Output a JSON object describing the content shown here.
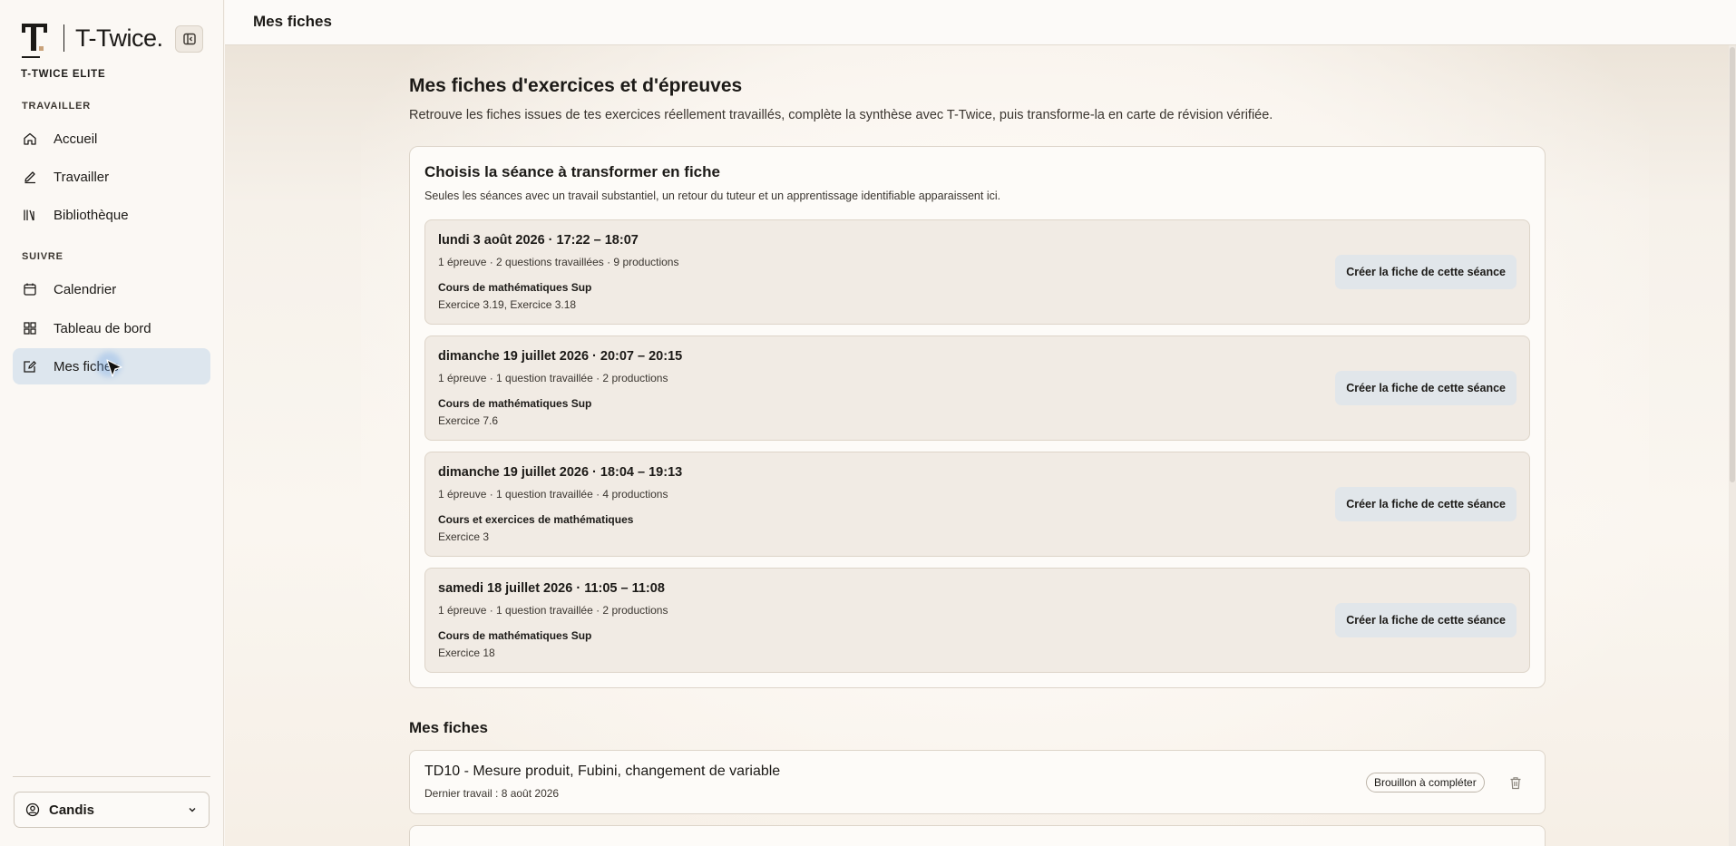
{
  "app": {
    "brand_name": "T-Twice.",
    "plan": "T-TWICE ELITE"
  },
  "sidebar": {
    "sections": [
      {
        "label": "TRAVAILLER"
      },
      {
        "label": "SUIVRE"
      }
    ],
    "items": [
      {
        "label": "Accueil",
        "icon": "home-icon"
      },
      {
        "label": "Travailler",
        "icon": "pencil-icon"
      },
      {
        "label": "Bibliothèque",
        "icon": "library-icon"
      },
      {
        "label": "Calendrier",
        "icon": "calendar-icon"
      },
      {
        "label": "Tableau de bord",
        "icon": "dashboard-icon"
      },
      {
        "label": "Mes fiches",
        "icon": "edit-note-icon",
        "active": true
      }
    ],
    "user": {
      "name": "Candis",
      "icon": "user-circle-icon"
    }
  },
  "topbar": {
    "title": "Mes fiches"
  },
  "main": {
    "title": "Mes fiches d'exercices et d'épreuves",
    "description": "Retrouve les fiches issues de tes exercices réellement travaillés, complète la synthèse avec T-Twice, puis transforme-la en carte de révision vérifiée.",
    "session_panel": {
      "title": "Choisis la séance à transformer en fiche",
      "subtitle": "Seules les séances avec un travail substantiel, un retour du tuteur et un apprentissage identifiable apparaissent ici.",
      "sessions": [
        {
          "date": "lundi 3 août 2026 · 17:22 – 18:07",
          "meta": "1 épreuve · 2 questions travaillées · 9 productions",
          "course": "Cours de mathématiques Sup",
          "exercises": "Exercice 3.19, Exercice 3.18",
          "button": "Créer la fiche de cette séance"
        },
        {
          "date": "dimanche 19 juillet 2026 · 20:07 – 20:15",
          "meta": "1 épreuve · 1 question travaillée · 2 productions",
          "course": "Cours de mathématiques Sup",
          "exercises": "Exercice 7.6",
          "button": "Créer la fiche de cette séance"
        },
        {
          "date": "dimanche 19 juillet 2026 · 18:04 – 19:13",
          "meta": "1 épreuve · 1 question travaillée · 4 productions",
          "course": "Cours et exercices de mathématiques",
          "exercises": "Exercice 3",
          "button": "Créer la fiche de cette séance"
        },
        {
          "date": "samedi 18 juillet 2026 · 11:05 – 11:08",
          "meta": "1 épreuve · 1 question travaillée · 2 productions",
          "course": "Cours de mathématiques Sup",
          "exercises": "Exercice 18",
          "button": "Créer la fiche de cette séance"
        }
      ]
    },
    "fiches": {
      "title": "Mes fiches",
      "items": [
        {
          "title": "TD10 - Mesure produit, Fubini, changement de variable",
          "last_work": "Dernier travail : 8 août 2026",
          "status": "Brouillon à compléter"
        }
      ]
    }
  },
  "colors": {
    "active_nav": "#dde6ee",
    "session_card": "#f1ebe4",
    "button_bg": "#e1e6ea"
  }
}
